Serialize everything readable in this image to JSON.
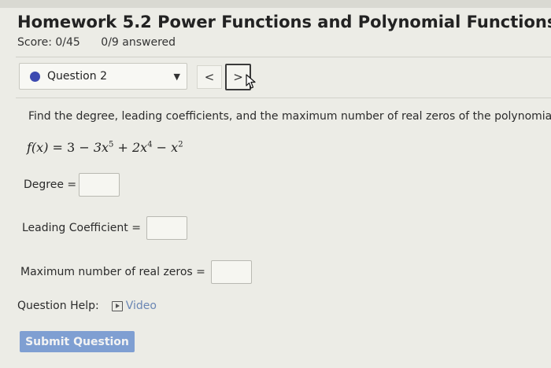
{
  "header": {
    "title": "Homework 5.2 Power Functions and Polynomial Functions",
    "score": "Score: 0/45",
    "answered": "0/9 answered"
  },
  "question_nav": {
    "selected": "Question 2",
    "prev_label": "<",
    "next_label": ">"
  },
  "question": {
    "prompt": "Find the degree, leading coefficients, and the maximum number of real zeros of the polynomial",
    "function": {
      "lhs": "f(x)",
      "t1": "3",
      "t2_coef": "3x",
      "t2_exp": "5",
      "t3_coef": "2x",
      "t3_exp": "4",
      "t4_coef": "x",
      "t4_exp": "2"
    }
  },
  "fields": {
    "degree_label": "Degree =",
    "leading_label": "Leading Coefficient =",
    "zeros_label": "Maximum number of real zeros ="
  },
  "help": {
    "label": "Question Help:",
    "video": "Video"
  },
  "submit_label": "Submit Question",
  "colors": {
    "accent": "#3d4ab0",
    "submit_bg": "#7f9fd2",
    "link": "#6a86b4"
  }
}
